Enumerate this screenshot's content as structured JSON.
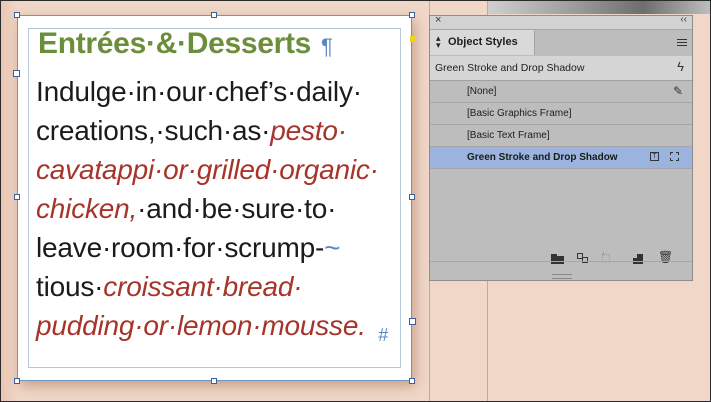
{
  "document": {
    "headline": "Entrées·&·Desserts",
    "pilcrow": "¶",
    "body_lines": [
      {
        "plain": "Indulge·in·our·chef’s·daily·",
        "italic": ""
      },
      {
        "plain": "creations,·such·as·",
        "italic": "pesto·"
      },
      {
        "plain": "",
        "italic": "cavatappi·or·grilled·organic·"
      },
      {
        "plain": "",
        "italic": "chicken,",
        "plain_after": "·and·be·sure·to·"
      },
      {
        "plain": "leave·room·for·scrump‑",
        "marker": "~"
      },
      {
        "plain": "tious·",
        "italic": "croissant·bread·"
      },
      {
        "plain": "",
        "italic": "pudding·or·lemon·mousse.",
        "marker": "#"
      }
    ]
  },
  "panel": {
    "title": "Object Styles",
    "current_style": "Green Stroke and Drop Shadow",
    "styles": [
      {
        "label": "[None]",
        "icon": "x-pencil-icon"
      },
      {
        "label": "[Basic Graphics Frame]"
      },
      {
        "label": "[Basic Text Frame]"
      },
      {
        "label": "Green Stroke and Drop Shadow",
        "selected": true
      }
    ],
    "bottom_buttons": [
      "folder-icon",
      "clear-overrides-icon",
      "break-link-icon",
      "new-style-icon",
      "trash-icon"
    ]
  },
  "colors": {
    "headline_green": "#6a8e3a",
    "italic_red": "#a7342a",
    "invisible_blue": "#5b86c5",
    "selection_blue": "#9ab4df",
    "pasteboard_peach": "#f0d7c8"
  }
}
